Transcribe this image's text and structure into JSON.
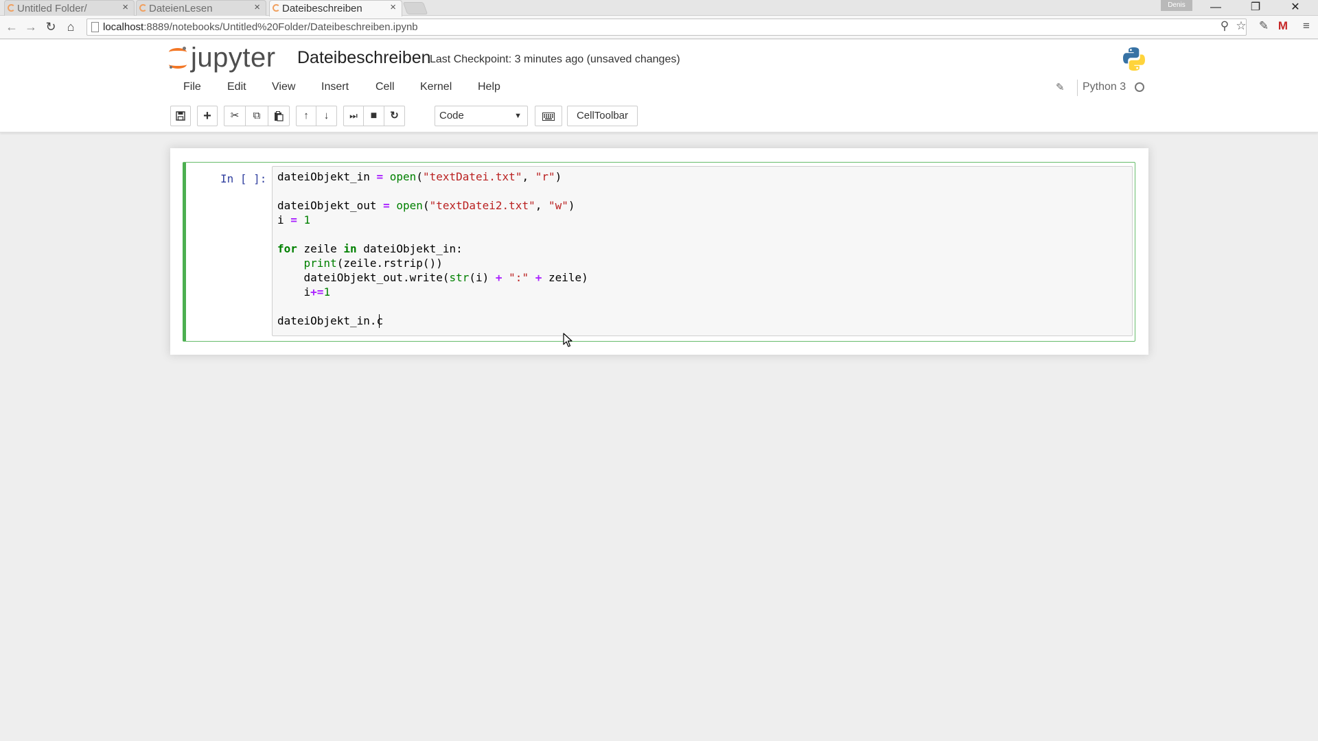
{
  "browser": {
    "tabs": [
      {
        "label": "Untitled Folder/",
        "active": false
      },
      {
        "label": "DateienLesen",
        "active": false
      },
      {
        "label": "Dateibeschreiben",
        "active": true
      }
    ],
    "tab_close_glyph": "×",
    "profile_name": "Denis",
    "window_controls": {
      "minimize": "—",
      "restore": "❐",
      "close": "✕"
    },
    "nav": {
      "back": "←",
      "forward": "→",
      "reload": "↻",
      "home": "⌂"
    },
    "url_host": "localhost",
    "url_rest": ":8889/notebooks/Untitled%20Folder/Dateibeschreiben.ipynb",
    "addr_icons": {
      "zoom": "⚲",
      "star": "☆",
      "ext1": "✎",
      "ext2": "M",
      "menu": "≡"
    }
  },
  "jupyter": {
    "logo_word": "jupyter",
    "notebook_title": "Dateibeschreiben",
    "checkpoint": "Last Checkpoint: 3 minutes ago (unsaved changes)",
    "menus": [
      "File",
      "Edit",
      "View",
      "Insert",
      "Cell",
      "Kernel",
      "Help"
    ],
    "kernel_name": "Python 3",
    "edit_icon": "✎",
    "toolbar": {
      "save": "🖫",
      "add": "+",
      "cut": "✂",
      "copy": "⧉",
      "paste": "📋",
      "move_up": "↑",
      "move_down": "↓",
      "run": "⏭",
      "stop": "■",
      "restart": "↻",
      "cell_type": "Code",
      "caret": "▼",
      "keyboard": "⌨",
      "celltoolbar": "CellToolbar"
    }
  },
  "cell": {
    "prompt": "In [ ]:",
    "code_lines": [
      "dateiObjekt_in = open(\"textDatei.txt\", \"r\")",
      "",
      "dateiObjekt_out = open(\"textDatei2.txt\", \"w\")",
      "i = 1",
      "",
      "for zeile in dateiObjekt_in:",
      "    print(zeile.rstrip())",
      "    dateiObjekt_out.write(str(i) + \":\" + zeile)",
      "    i+=1",
      "",
      "dateiObjekt_in.c"
    ]
  },
  "colors": {
    "cell_border_edit": "#66bb6a",
    "cell_left_bar": "#4caf50",
    "jupyter_orange": "#f37726",
    "prompt_in": "#303f9f",
    "keyword": "#008000",
    "string": "#ba2121",
    "operator": "#aa22ff"
  }
}
